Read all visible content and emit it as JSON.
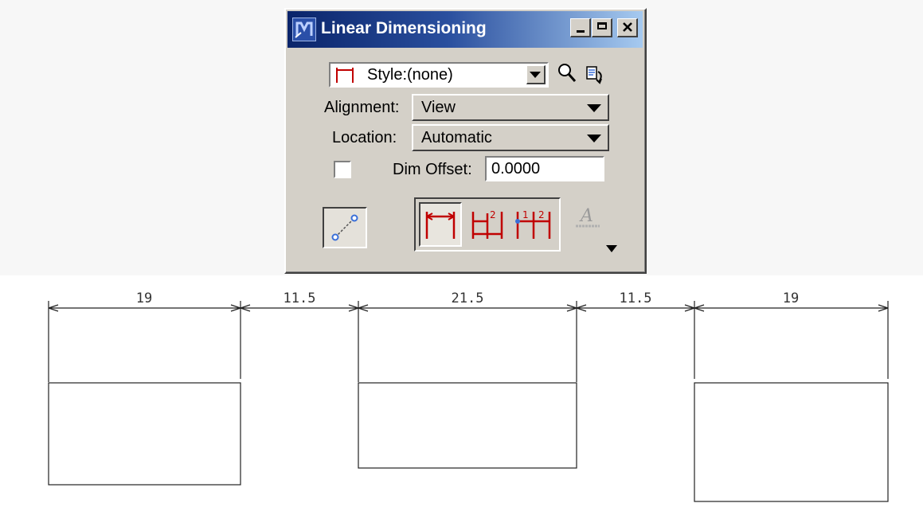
{
  "window": {
    "title": "Linear Dimensioning",
    "icon": "microstation-app-icon",
    "controls": [
      "minimize-icon",
      "maximize-icon",
      "close-icon"
    ]
  },
  "style_field": {
    "value": "Style:(none)",
    "icons": [
      "dimension-style-icon",
      "chevron-down-icon",
      "magnifier-icon",
      "style-manager-icon"
    ]
  },
  "alignment": {
    "label": "Alignment:",
    "value": "View"
  },
  "location": {
    "label": "Location:",
    "value": "Automatic"
  },
  "dim_offset": {
    "checked": false,
    "label": "Dim Offset:",
    "value": "0.0000"
  },
  "tools": {
    "association_toggle": "association-icon",
    "dimension_modes": [
      "single-dimension-icon",
      "stacked-dimension-icon",
      "chained-dimension-icon"
    ],
    "selected_mode": "single-dimension-icon",
    "text_icon": "dimension-text-icon",
    "expand_icon": "triangle-down-icon"
  },
  "drawing": {
    "dimensions": [
      "19",
      "11.5",
      "21.5",
      "11.5",
      "19"
    ],
    "line_color": "#222222"
  },
  "colors": {
    "titlebar_start": "#0a246a",
    "titlebar_end": "#a6caf0",
    "dim_red": "#c00000",
    "face": "#d4d0c8"
  }
}
